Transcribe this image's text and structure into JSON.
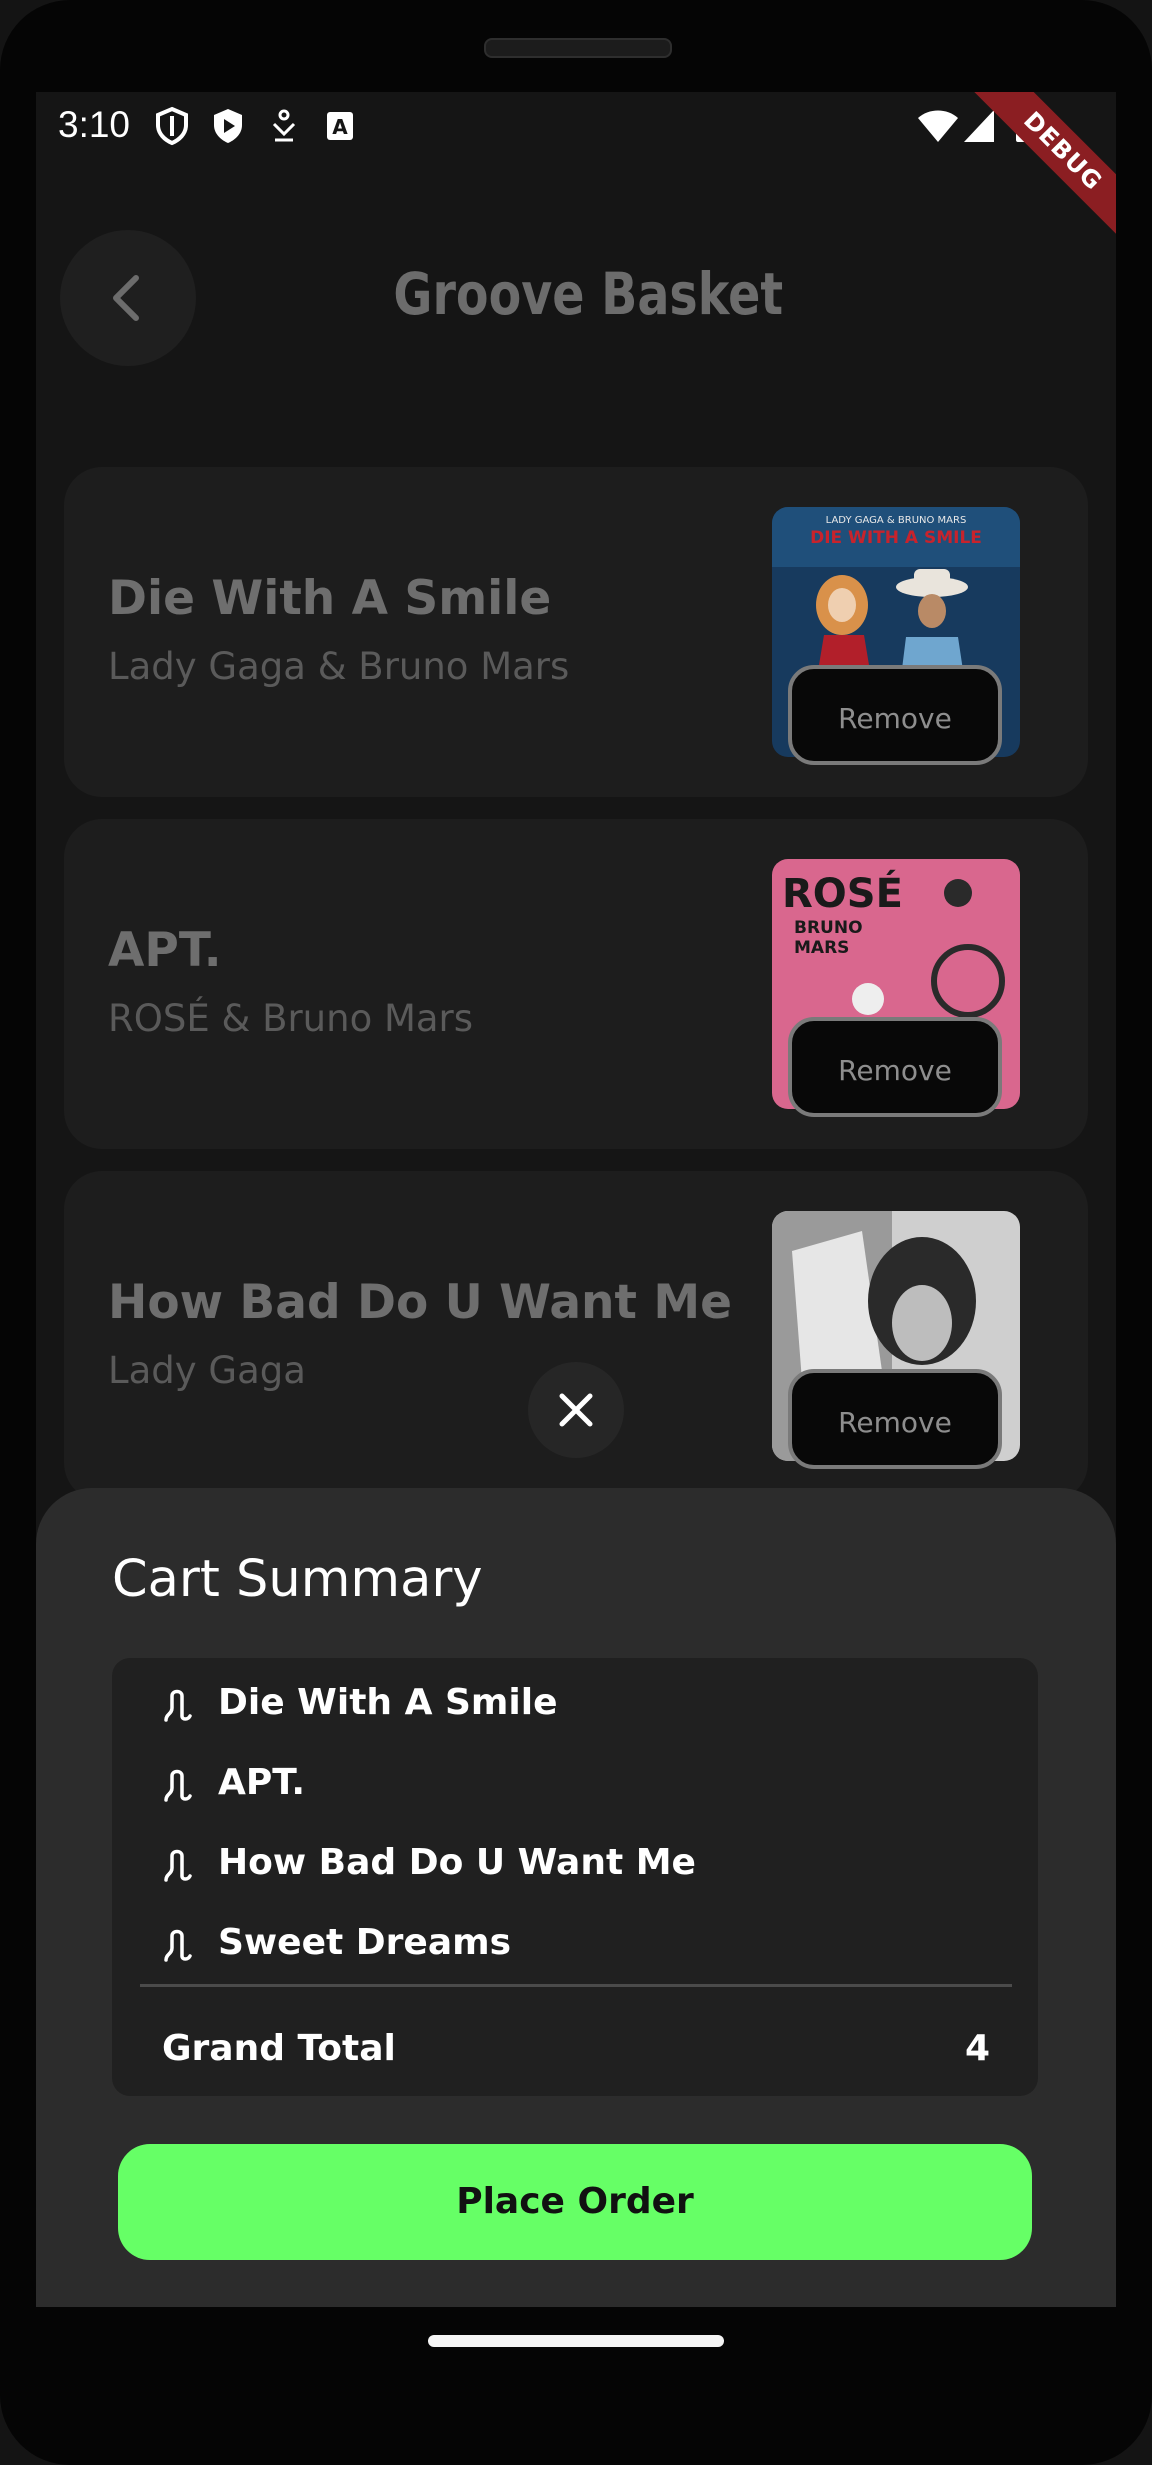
{
  "status_bar": {
    "time": "3:10",
    "debug_label": "DEBUG"
  },
  "header": {
    "title": "Groove Basket"
  },
  "cart_items": [
    {
      "title": "Die With A Smile",
      "artist": "Lady Gaga & Bruno Mars",
      "remove_label": "Remove",
      "cover_text": "LADY GAGA & BRUNO MARS / DIE WITH A SMILE"
    },
    {
      "title": "APT.",
      "artist": "ROSÉ & Bruno Mars",
      "remove_label": "Remove",
      "cover_text": "ROSÉ / BRUNO MARS"
    },
    {
      "title": "How Bad Do U Want Me",
      "artist": "Lady Gaga",
      "remove_label": "Remove",
      "cover_text": ""
    }
  ],
  "summary": {
    "title": "Cart Summary",
    "items": [
      "Die With A Smile",
      "APT.",
      "How Bad Do U Want Me",
      "Sweet Dreams"
    ],
    "grand_total_label": "Grand Total",
    "grand_total_value": "4",
    "place_order_label": "Place Order"
  },
  "colors": {
    "accent": "#66ff66",
    "background": "#151515",
    "sheet": "#2c2c2c",
    "debug_banner": "#8b1e22"
  }
}
